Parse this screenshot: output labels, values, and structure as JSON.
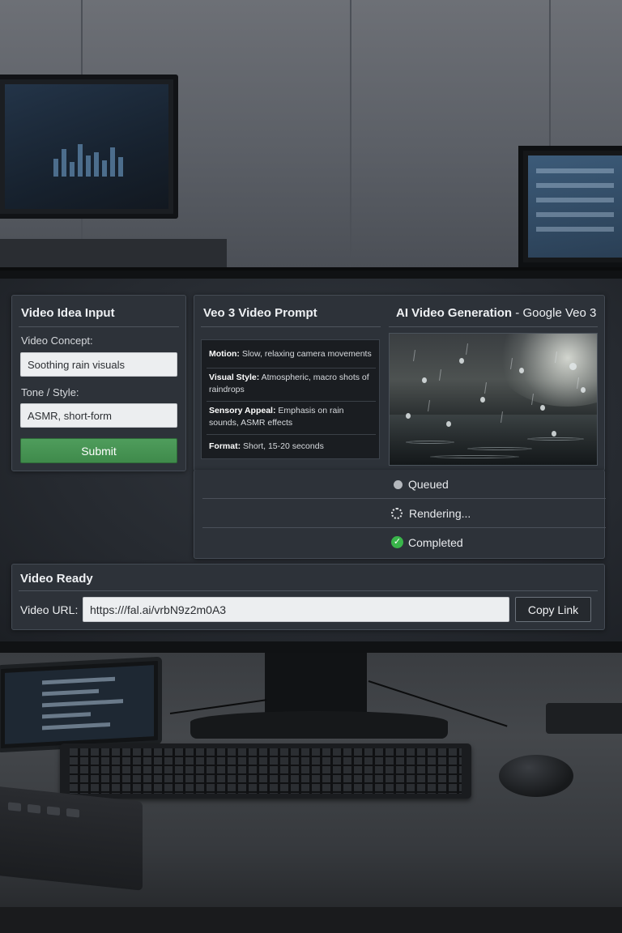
{
  "idea_panel": {
    "title": "Video Idea Input",
    "concept_label": "Video Concept:",
    "concept_value": "Soothing rain visuals",
    "tone_label": "Tone / Style:",
    "tone_value": "ASMR, short-form",
    "submit_label": "Submit"
  },
  "prompt_panel": {
    "title": "Veo 3 Video Prompt",
    "items": [
      {
        "key": "Motion:",
        "text": "Slow, relaxing camera movements"
      },
      {
        "key": "Visual Style:",
        "text": "Atmospheric, macro shots of raindrops"
      },
      {
        "key": "Sensory Appeal:",
        "text": "Emphasis on rain sounds, ASMR effects"
      },
      {
        "key": "Format:",
        "text": "Short, 15-20 seconds"
      }
    ]
  },
  "generation_panel": {
    "title": "AI Video Generation",
    "separator": "-",
    "provider": "Google Veo 3",
    "statuses": [
      {
        "label": "Queued",
        "icon": "queued-dot-icon"
      },
      {
        "label": "Rendering...",
        "icon": "spinner-icon"
      },
      {
        "label": "Completed",
        "icon": "check-circle-icon"
      }
    ]
  },
  "video_ready": {
    "title": "Video Ready",
    "url_label": "Video URL:",
    "url_value": "https:///fal.ai/vrbN9z2m0A3",
    "copy_label": "Copy Link"
  },
  "colors": {
    "submit_green": "#4f9d5c",
    "completed_green": "#39b54a",
    "panel_bg": "#2d3239"
  }
}
